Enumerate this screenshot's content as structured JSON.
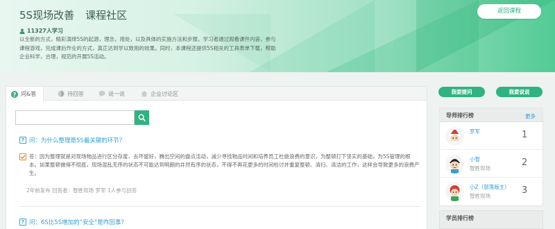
{
  "hero": {
    "title_main": "5S现场改善",
    "title_sub": "课程社区",
    "learners": "11327人学习",
    "intro": "以全新的方式，精彩演绎5S的起源，理念，用处，以及具体的实施方法和步骤。学习者通过观看课件内容，参与课程游戏，完成课后作业的方式，真正达到学以致用的效果。同时，本课程还提供5S相关的工具表单下载，帮助企业科学，合理，规范的开展5S活动。",
    "back_button": "返回课程"
  },
  "tabs": [
    {
      "label": "问&答",
      "icon": "question-icon"
    },
    {
      "label": "待回答",
      "icon": "pending-icon"
    },
    {
      "label": "说一说",
      "icon": "chat-icon"
    },
    {
      "label": "企业讨论区",
      "icon": "home-icon"
    }
  ],
  "search": {
    "placeholder": ""
  },
  "questions": [
    {
      "question": "问：为什么整理是5S最关键的环节？",
      "answer": "答：因为整理就是对现场物品进行区分存废、去坏留好，腾出空间的盘点活动，减少寻找物品时间和培养员工杜绝浪费的意识，为整顿打下坚实的基础，为5S管理的根本。如果整顿做得不彻底，现场混乱无序的状态不可能达到明朗的井然有序的状态，不得不再花更多的时间检讨并重复整顿、清扫、清洁的工作，这样会导致更多的浪费产生。",
      "meta": "2年前发布 回答者：智胜现场 罗军 1人参与回答"
    },
    {
      "question": "问：6S比5S增加的“安全”是咋回事？"
    }
  ],
  "sidebar": {
    "ask_button": "我要提问",
    "say_button": "我要说说",
    "teacher_rank": {
      "title": "导师排行榜",
      "more": "更多",
      "items": [
        {
          "name": "罗军",
          "dept": "",
          "rank": "1"
        },
        {
          "name": "小智",
          "dept": "智胜现场",
          "rank": "2"
        },
        {
          "name": "小Z（部落版主）",
          "dept": "智胜现场",
          "rank": "3"
        }
      ]
    },
    "student_rank": {
      "title": "学员排行榜"
    }
  },
  "colors": {
    "brand_green": "#2fb380",
    "link_blue": "#2f9fd6",
    "answer_orange": "#e48a2a"
  }
}
